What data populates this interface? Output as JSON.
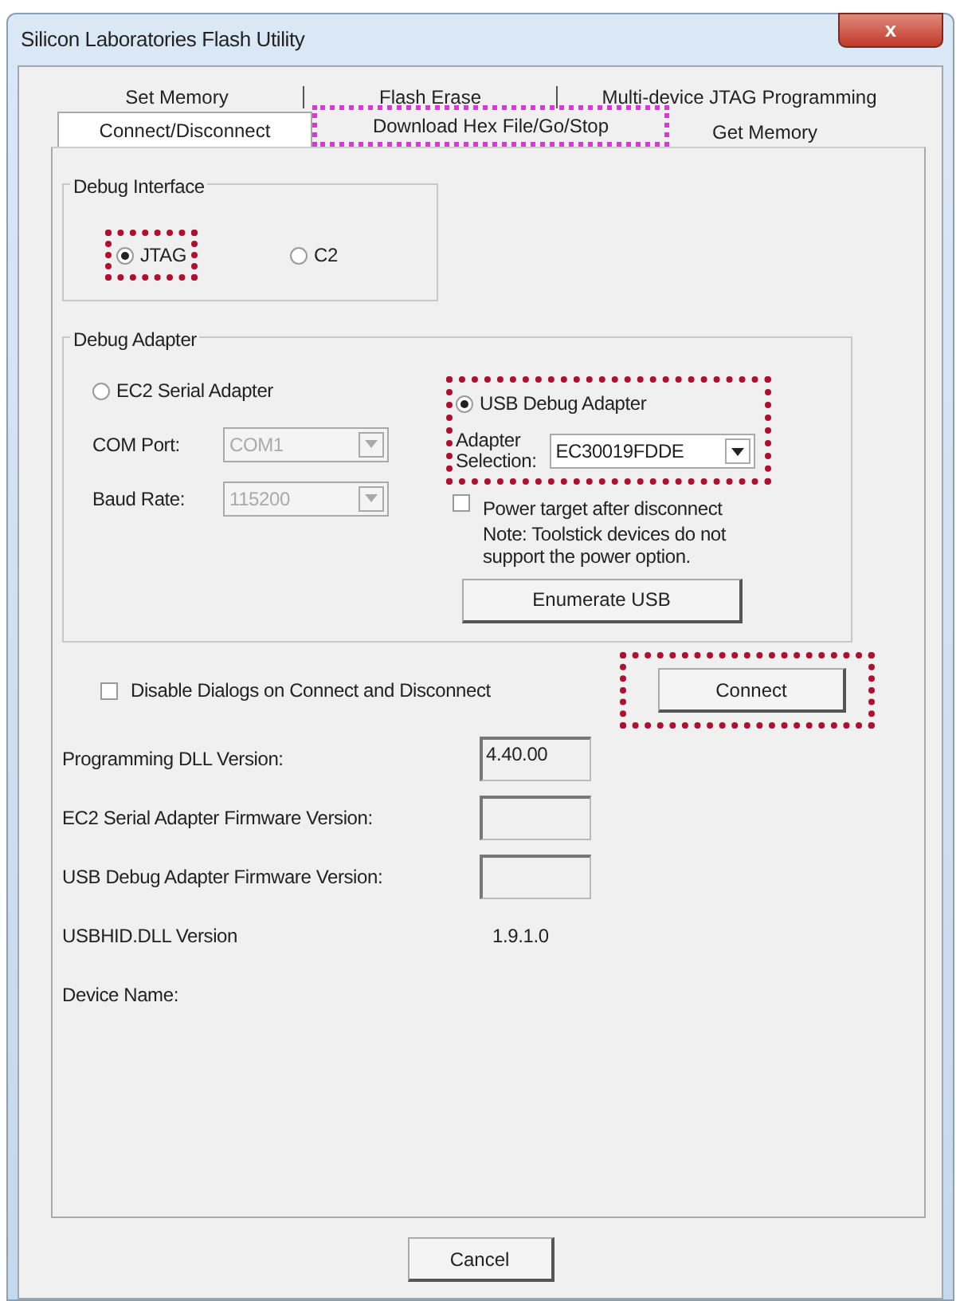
{
  "window": {
    "title": "Silicon Laboratories Flash Utility",
    "close": "x"
  },
  "tabs": {
    "back_row": [
      {
        "label": "Set Memory",
        "selected": false,
        "highlighted": false
      },
      {
        "label": "Flash Erase",
        "selected": false,
        "highlighted": false
      },
      {
        "label": "Multi-device JTAG Programming",
        "selected": false,
        "highlighted": false
      }
    ],
    "front_row": [
      {
        "label": "Connect/Disconnect",
        "selected": true,
        "highlighted": false
      },
      {
        "label": "Download Hex File/Go/Stop",
        "selected": false,
        "highlighted": true
      },
      {
        "label": "Get Memory",
        "selected": false,
        "highlighted": false
      }
    ]
  },
  "debug_interface": {
    "title": "Debug Interface",
    "options": [
      {
        "label": "JTAG",
        "selected": true,
        "highlighted": true
      },
      {
        "label": "C2",
        "selected": false,
        "highlighted": false
      }
    ]
  },
  "debug_adapter": {
    "title": "Debug Adapter",
    "serial": {
      "label": "EC2 Serial Adapter",
      "selected": false,
      "com_port_label": "COM Port:",
      "com_port": "COM1",
      "baud_label": "Baud Rate:",
      "baud": "115200",
      "disabled": true
    },
    "usb": {
      "label": "USB Debug Adapter",
      "selected": true,
      "highlighted": true,
      "selection_label": "Adapter Selection:",
      "selection": "EC30019FDDE"
    },
    "power": {
      "label": "Power target after disconnect",
      "checked": false,
      "note": "Note: Toolstick devices do not support the power option."
    },
    "enumerate_button": "Enumerate USB"
  },
  "disable_dialogs": {
    "label": "Disable Dialogs on Connect and Disconnect",
    "checked": false
  },
  "connect_button": {
    "label": "Connect",
    "highlighted": true
  },
  "versions": [
    {
      "label": "Programming DLL Version:",
      "value": "4.40.00",
      "kind": "field"
    },
    {
      "label": "EC2 Serial Adapter Firmware Version:",
      "kind": "field"
    },
    {
      "label": "USB Debug Adapter Firmware Version:",
      "kind": "field"
    },
    {
      "label": "USBHID.DLL Version",
      "value": "1.9.1.0",
      "kind": "text"
    },
    {
      "label": "Device Name:",
      "kind": "text"
    }
  ],
  "cancel_button": "Cancel"
}
